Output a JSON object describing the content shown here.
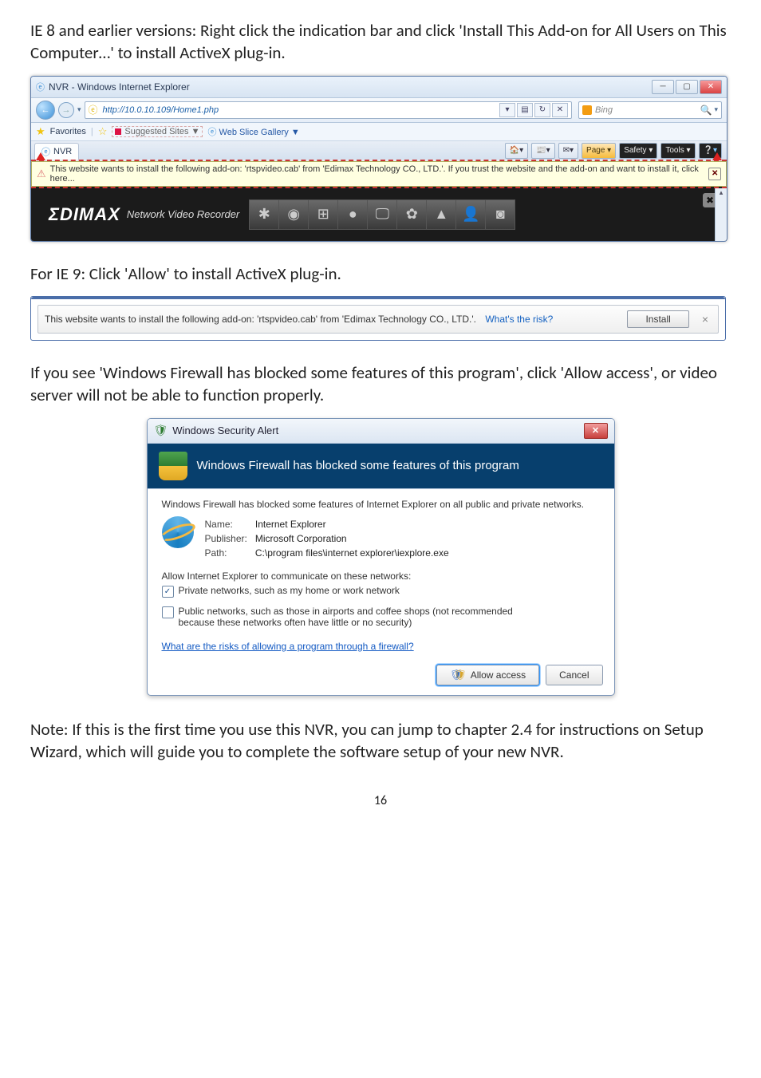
{
  "para1": "IE 8 and earlier versions: Right click the indication bar and click 'Install This Add-on for All Users on This Computer…' to install ActiveX plug-in.",
  "para2": "For IE 9: Click 'Allow' to install ActiveX plug-in.",
  "para3": "If you see 'Windows Firewall has blocked some features of this program', click 'Allow access', or video server will not be able to function properly.",
  "para4": "Note: If this is the first time you use this NVR, you can jump to chapter 2.4 for instructions on Setup Wizard, which will guide you to complete the software setup of your new NVR.",
  "pagenum": "16",
  "ie8": {
    "title": "NVR - Windows Internet Explorer",
    "url": "http://10.0.10.109/Home1.php",
    "bing_placeholder": "Bing",
    "fav_label": "Favorites",
    "suggested": "Suggested Sites ▼",
    "webslice": "Web Slice Gallery ▼",
    "tab_label": "NVR",
    "tool_page": "Page ▾",
    "tool_safety": "Safety ▾",
    "tool_tools": "Tools ▾",
    "infobar": "This website wants to install the following add-on: 'rtspvideo.cab' from 'Edimax Technology CO., LTD.'. If you trust the website and the add-on and want to install it, click here...",
    "edimax_logo": "ΣDIMAX",
    "edimax_sub": "Network Video Recorder"
  },
  "ie9": {
    "message": "This website wants to install the following add-on: 'rtspvideo.cab' from 'Edimax Technology CO., LTD.'.",
    "risk": "What's the risk?",
    "install": "Install"
  },
  "wsa": {
    "title": "Windows Security Alert",
    "banner": "Windows Firewall has blocked some features of this program",
    "lead": "Windows Firewall has blocked some features of Internet Explorer on all public and private networks.",
    "name_label": "Name:",
    "name_value": "Internet Explorer",
    "pub_label": "Publisher:",
    "pub_value": "Microsoft Corporation",
    "path_label": "Path:",
    "path_value": "C:\\program files\\internet explorer\\iexplore.exe",
    "allow_label": "Allow Internet Explorer to communicate on these networks:",
    "chk_private": "Private networks, such as my home or work network",
    "chk_public_line1": "Public networks, such as those in airports and coffee shops (not recommended",
    "chk_public_line2": "because these networks often have little or no security)",
    "risks_link": "What are the risks of allowing a program through a firewall?",
    "btn_allow": "Allow access",
    "btn_cancel": "Cancel"
  }
}
